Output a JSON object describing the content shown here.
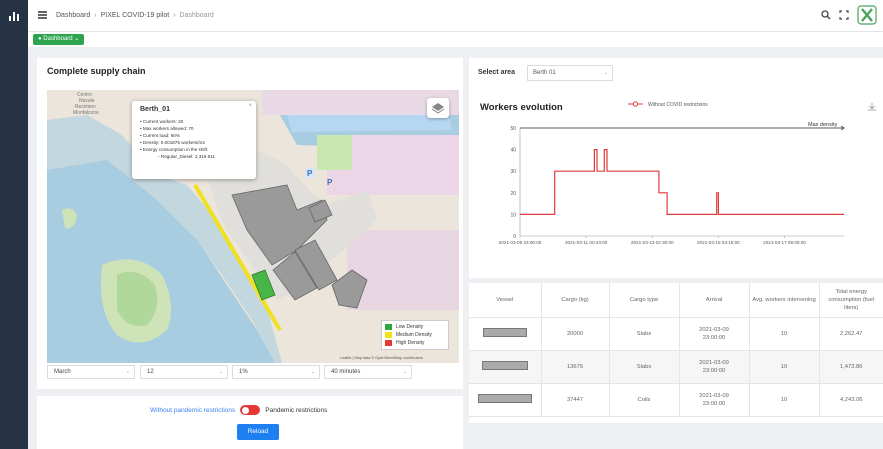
{
  "breadcrumb": {
    "home": "Dashboard",
    "pilot": "PIXEL COVID-19 pilot",
    "current": "Dashboard"
  },
  "dashboard_button": "● Dashboard ⌄",
  "supply_chain": {
    "title": "Complete supply chain",
    "map_labels": {
      "place": "Centro\nNavale\nRecimien\nMonfalcone",
      "parking": "P"
    },
    "popup": {
      "title": "Berth_01",
      "items": [
        "Current workers: 20",
        "Max workers allowed: 70",
        "Current load: 60%",
        "Density: 0.001875 workers/m2",
        "Energy consumption in the shift:"
      ],
      "sub_item": "Regular_Diesel: 2,319.611"
    },
    "legend": [
      {
        "label": "Low Density",
        "color": "#2fa83b"
      },
      {
        "label": "Medium Density",
        "color": "#f2e21a"
      },
      {
        "label": "High Density",
        "color": "#e53935"
      }
    ],
    "attribution": "Leaflet | Map data © OpenStreetMap contributors",
    "filters": {
      "month": "March",
      "day": "12",
      "percent": "1%",
      "duration": "40 minutes"
    }
  },
  "pandemic": {
    "without_label": "Without pandemic restrictions",
    "with_label": "Pandemic restrictions",
    "reload_label": "Reload"
  },
  "select_area": {
    "label": "Select area",
    "value": "Berth 01"
  },
  "chart_data": {
    "type": "line",
    "title": "Workers evolution",
    "legend": [
      "Without COVID restrictions"
    ],
    "annotations": [
      "Max density"
    ],
    "series": [
      {
        "name": "Without COVID restrictions",
        "color": "#e03b3b",
        "points": [
          [
            0,
            10
          ],
          [
            1.05,
            10
          ],
          [
            1.05,
            30
          ],
          [
            2.25,
            30
          ],
          [
            2.25,
            40
          ],
          [
            2.33,
            40
          ],
          [
            2.33,
            30
          ],
          [
            2.55,
            30
          ],
          [
            2.55,
            40
          ],
          [
            2.63,
            40
          ],
          [
            2.63,
            30
          ],
          [
            4.2,
            30
          ],
          [
            4.2,
            20
          ],
          [
            4.45,
            20
          ],
          [
            4.45,
            10
          ],
          [
            5.95,
            10
          ],
          [
            5.95,
            20
          ],
          [
            6.0,
            20
          ],
          [
            6.0,
            10
          ],
          [
            9.8,
            10
          ]
        ]
      }
    ],
    "max_density": 50,
    "ylim": [
      0,
      50
    ],
    "yticks": [
      0,
      10,
      20,
      30,
      40,
      50
    ],
    "xlim": [
      0,
      9.8
    ],
    "xticks": [
      {
        "pos": 0,
        "label": "2021-03-09 23:00:00"
      },
      {
        "pos": 2,
        "label": "2021-03-11 00:43:00"
      },
      {
        "pos": 4,
        "label": "2021-03-13 02:30:00"
      },
      {
        "pos": 6,
        "label": "2021-03-15 04:15:00"
      },
      {
        "pos": 8,
        "label": "2021-03-17 06:00:00"
      }
    ]
  },
  "vessel_table": {
    "headers": [
      "Vessel",
      "Cargo (kg)",
      "Cargo type",
      "Arrival",
      "Avg. workers intervening",
      "Total energy consumption (fuel liters)"
    ],
    "rows": [
      {
        "cargo": "20000",
        "type": "Slabs",
        "arrival": "2021-03-09\n23:00:00",
        "workers": "10",
        "energy": "2,262.47"
      },
      {
        "cargo": "13675",
        "type": "Slabs",
        "arrival": "2021-03-09\n23:00:00",
        "workers": "10",
        "energy": "1,473.86"
      },
      {
        "cargo": "37447",
        "type": "Coils",
        "arrival": "2021-03-09\n23:00:00",
        "workers": "10",
        "energy": "4,243.06"
      }
    ]
  }
}
